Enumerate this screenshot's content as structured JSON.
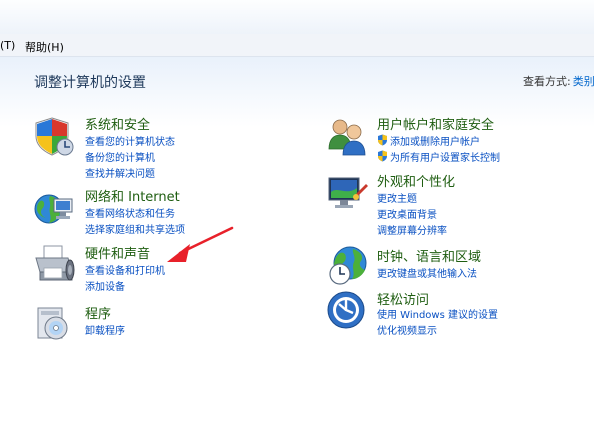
{
  "menubar": {
    "items": [
      {
        "label": "(T)"
      },
      {
        "label": "帮助(H)"
      }
    ]
  },
  "header": {
    "title": "调整计算机的设置",
    "view_by_label": "查看方式:",
    "view_by_value": "类别"
  },
  "categories": {
    "system_security": {
      "title": "系统和安全",
      "links": [
        "查看您的计算机状态",
        "备份您的计算机",
        "查找并解决问题"
      ]
    },
    "network": {
      "title": "网络和 Internet",
      "links": [
        "查看网络状态和任务",
        "选择家庭组和共享选项"
      ]
    },
    "hardware_sound": {
      "title": "硬件和声音",
      "links": [
        "查看设备和打印机",
        "添加设备"
      ]
    },
    "programs": {
      "title": "程序",
      "links": [
        "卸载程序"
      ]
    },
    "user_accounts": {
      "title": "用户帐户和家庭安全",
      "links": [
        "添加或删除用户帐户",
        "为所有用户设置家长控制"
      ]
    },
    "appearance": {
      "title": "外观和个性化",
      "links": [
        "更改主题",
        "更改桌面背景",
        "调整屏幕分辨率"
      ]
    },
    "clock_region": {
      "title": "时钟、语言和区域",
      "links": [
        "更改键盘或其他输入法"
      ]
    },
    "ease_access": {
      "title": "轻松访问",
      "links": [
        "使用 Windows 建议的设置",
        "优化视频显示"
      ]
    }
  },
  "colors": {
    "category_title": "#1e5d10",
    "link": "#0950c2",
    "annotation_arrow": "#e8212a"
  }
}
